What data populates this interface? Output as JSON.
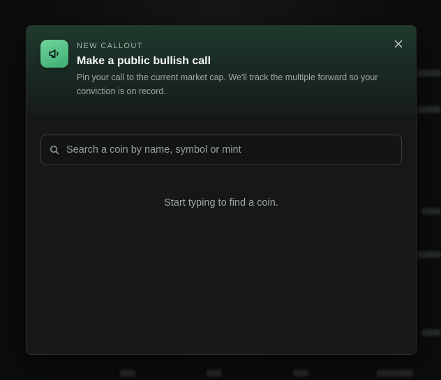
{
  "modal": {
    "eyebrow": "NEW CALLOUT",
    "title": "Make a public bullish call",
    "subtitle": "Pin your call to the current market cap. We'll track the multiple forward so your conviction is on record.",
    "header_icon": "megaphone-icon",
    "close_icon": "close-icon"
  },
  "search": {
    "placeholder": "Search a coin by name, symbol or mint",
    "value": "",
    "icon": "search-icon"
  },
  "empty_state": {
    "text": "Start typing to find a coin."
  },
  "colors": {
    "accent": "#4fbf82",
    "header_gradient_top": "#1f3a2d",
    "modal_bg": "#161818",
    "page_bg": "#0c0d0d"
  }
}
